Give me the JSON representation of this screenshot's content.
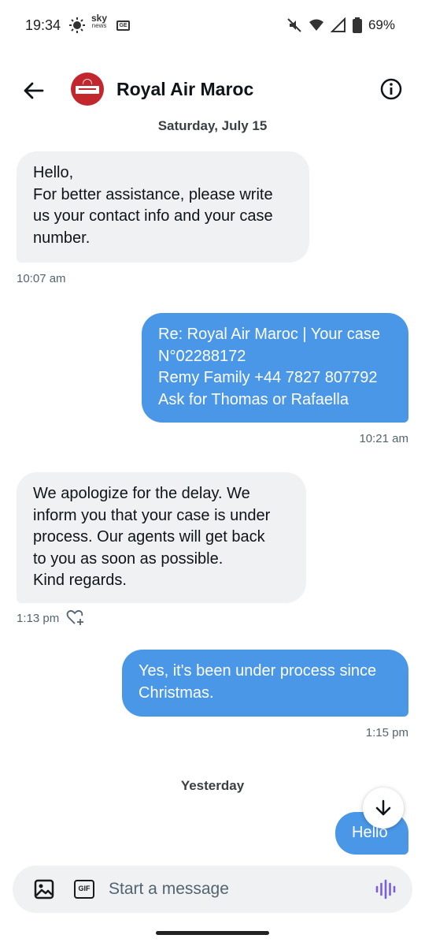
{
  "status_bar": {
    "time": "19:34",
    "sky_top": "sky",
    "sky_bottom": "news",
    "news_badge": "GE",
    "battery": "69%",
    "icons": [
      "weather-sun-icon",
      "sky-news-icon",
      "news-icon",
      "mute-icon",
      "wifi-icon",
      "signal-icon",
      "battery-icon"
    ]
  },
  "header": {
    "title": "Royal Air Maroc",
    "back_icon": "arrow-left-icon",
    "info_icon": "info-icon"
  },
  "messages": {
    "day1": "Saturday, July 15",
    "m1": {
      "lines": [
        "Hello,",
        "For better assistance, please write",
        "us your contact info and your case",
        "number."
      ],
      "time": "10:07 am"
    },
    "m2": {
      "lines": [
        "Re: Royal Air Maroc | Your case",
        "N°02288172",
        "Remy Family +44 7827 807792",
        "Ask for Thomas or Rafaella"
      ],
      "time": "10:21 am"
    },
    "m3": {
      "lines": [
        "We apologize for the delay. We",
        "inform you that your case is under",
        "process. Our agents will get back",
        "to you as soon as possible.",
        "Kind regards."
      ],
      "time": "1:13 pm"
    },
    "m4": {
      "lines": [
        "Yes, it's been under process since",
        "Christmas."
      ],
      "time": "1:15 pm"
    },
    "day2": "Yesterday",
    "m5": {
      "lines": [
        "Hello"
      ]
    }
  },
  "composer": {
    "placeholder": "Start a message",
    "gif_label": "GIF"
  },
  "colors": {
    "outgoing_bubble": "#4a97e8",
    "incoming_bubble": "#eff1f2",
    "brand_red": "#c1272d",
    "voice_accent": "#7b5fd6"
  }
}
